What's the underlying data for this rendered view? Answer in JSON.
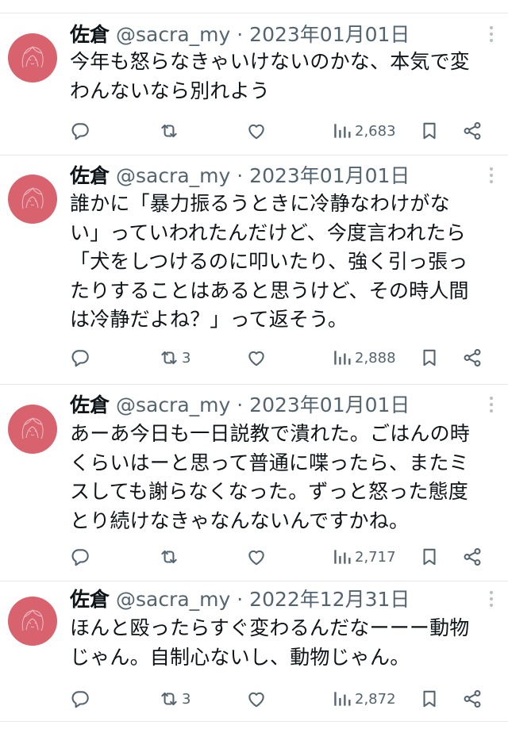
{
  "colors": {
    "avatar": "#d9626f",
    "text": "#0f1419",
    "secondary": "#536471",
    "divider": "#e6e9ec"
  },
  "tweets": [
    {
      "name": "佐倉",
      "handle": "@sacra_my",
      "separator": "·",
      "date": "2023年01月01日",
      "text": "今年も怒らなきゃいけないのかな、本気で変\nわんないなら別れよう",
      "retweets": "",
      "views": "2,683",
      "icons": [
        "reply-icon",
        "retweet-icon",
        "like-icon",
        "views-icon",
        "bookmark-icon",
        "share-icon",
        "more-icon"
      ]
    },
    {
      "name": "佐倉",
      "handle": "@sacra_my",
      "separator": "·",
      "date": "2023年01月01日",
      "text": "誰かに「暴力振るうときに冷静なわけがな\nい」っていわれたんだけど、今度言われたら\n「犬をしつけるのに叩いたり、強く引っ張っ\nたりすることはあると思うけど、その時人間\nは冷静だよね？」って返そう。",
      "retweets": "3",
      "views": "2,888",
      "icons": [
        "reply-icon",
        "retweet-icon",
        "like-icon",
        "views-icon",
        "bookmark-icon",
        "share-icon",
        "more-icon"
      ]
    },
    {
      "name": "佐倉",
      "handle": "@sacra_my",
      "separator": "·",
      "date": "2023年01月01日",
      "text": "あーあ今日も一日説教で潰れた。ごはんの時\nくらいはーと思って普通に喋ったら、またミ\nスしても謝らなくなった。ずっと怒った態度\nとり続けなきゃなんないんですかね。",
      "retweets": "",
      "views": "2,717",
      "icons": [
        "reply-icon",
        "retweet-icon",
        "like-icon",
        "views-icon",
        "bookmark-icon",
        "share-icon",
        "more-icon"
      ]
    },
    {
      "name": "佐倉",
      "handle": "@sacra_my",
      "separator": "·",
      "date": "2022年12月31日",
      "text": "ほんと殴ったらすぐ変わるんだなーーー動物\nじゃん。自制心ないし、動物じゃん。",
      "retweets": "3",
      "views": "2,872",
      "icons": [
        "reply-icon",
        "retweet-icon",
        "like-icon",
        "views-icon",
        "bookmark-icon",
        "share-icon",
        "more-icon"
      ]
    }
  ]
}
